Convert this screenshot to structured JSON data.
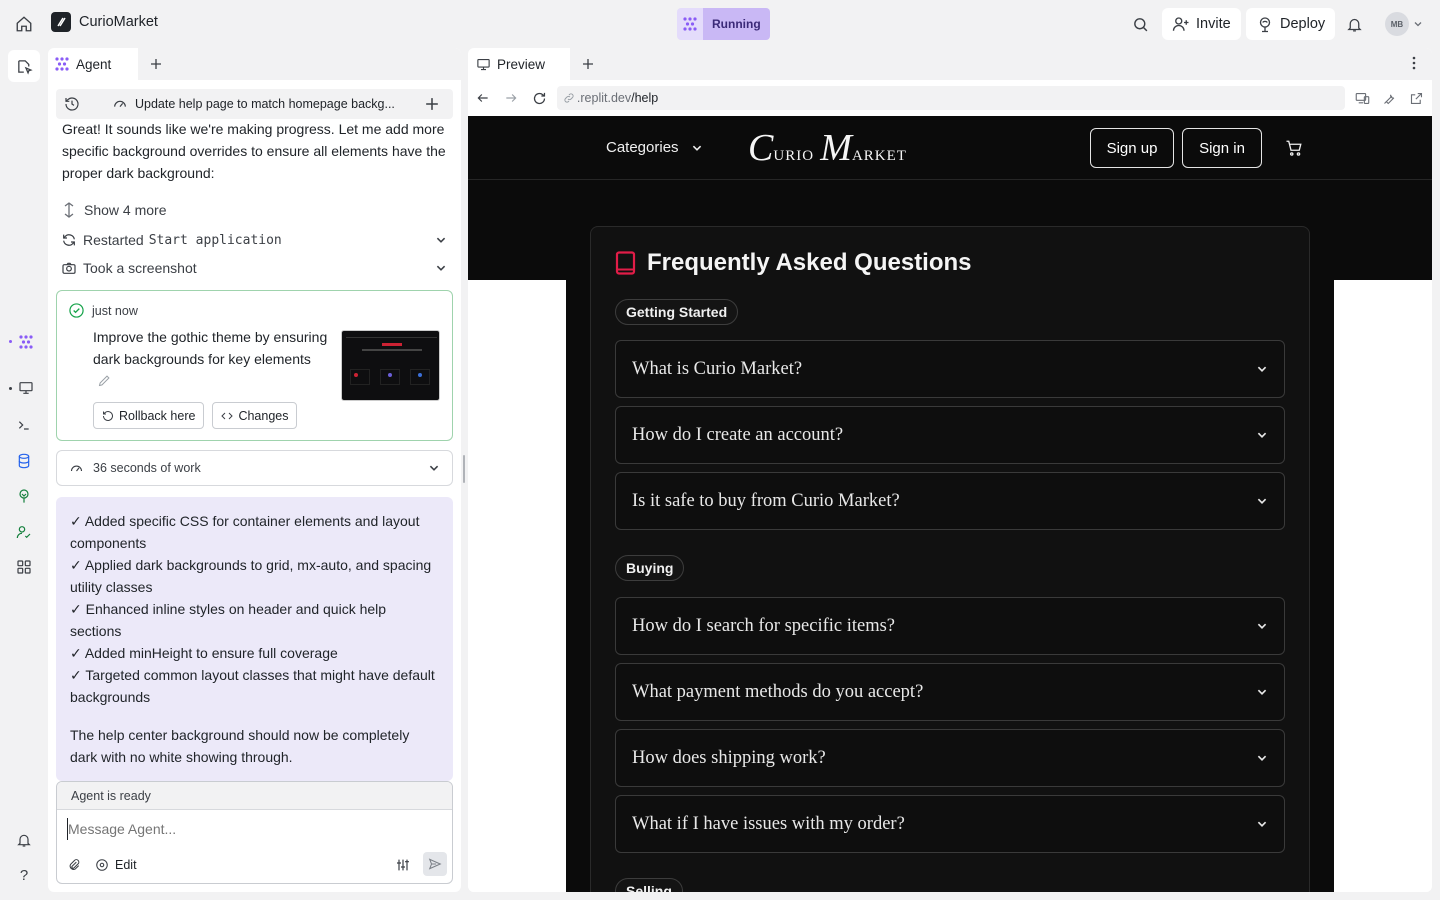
{
  "topbar": {
    "project_name": "CurioMarket",
    "status_label": "Running",
    "invite_label": "Invite",
    "deploy_label": "Deploy",
    "avatar_initials": "MB"
  },
  "agent": {
    "tab_label": "Agent",
    "thread_title": "Update help page to match homepage backg...",
    "intro_message": "Great! It sounds like we're making progress. Let me add more specific background overrides to ensure all elements have the proper dark background:",
    "show_more_label": "Show 4 more",
    "restarted_prefix": "Restarted",
    "restarted_code": "Start application",
    "screenshot_label": "Took a screenshot",
    "checkpoint": {
      "time": "just now",
      "description": "Improve the gothic theme by ensuring dark backgrounds for key elements",
      "rollback_label": "Rollback here",
      "changes_label": "Changes"
    },
    "work_summary": "36 seconds of work",
    "bullets": [
      "✓ Added specific CSS for container elements and layout components",
      "✓ Applied dark backgrounds to grid, mx-auto, and spacing utility classes",
      "✓ Enhanced inline styles on header and quick help sections",
      "✓ Added minHeight to ensure full coverage",
      "✓ Targeted common layout classes that might have default backgrounds"
    ],
    "closing_message": "The help center background should now be completely dark with no white showing through.",
    "status": "Agent is ready",
    "input_placeholder": "Message Agent...",
    "edit_label": "Edit"
  },
  "preview": {
    "tab_label": "Preview",
    "url_prefix": ".replit.dev",
    "url_path": "/help",
    "site": {
      "categories_label": "Categories",
      "logo_text_1": "C",
      "logo_text_2": "urio ",
      "logo_text_3": "M",
      "logo_text_4": "arket",
      "signup_label": "Sign up",
      "signin_label": "Sign in",
      "faq_title": "Frequently Asked Questions",
      "sections": [
        {
          "name": "Getting Started",
          "questions": [
            "What is Curio Market?",
            "How do I create an account?",
            "Is it safe to buy from Curio Market?"
          ]
        },
        {
          "name": "Buying",
          "questions": [
            "How do I search for specific items?",
            "What payment methods do you accept?",
            "How does shipping work?",
            "What if I have issues with my order?"
          ]
        },
        {
          "name": "Selling",
          "questions": []
        }
      ]
    }
  },
  "colors": {
    "accent_purple": "#8a5cf6",
    "status_pill_bg": "#c9b8f5",
    "agent_bubble_bg": "#ece9f9",
    "faq_icon_red": "#e11d48",
    "site_bg": "#0b0b0b"
  },
  "icons": [
    "home-icon",
    "replit-logo-icon",
    "agent-icon",
    "search-icon",
    "invite-icon",
    "deploy-icon",
    "bell-icon",
    "history-icon",
    "plus-icon",
    "chevron-down-icon",
    "refresh-icon",
    "camera-icon",
    "check-circle-icon",
    "pencil-icon",
    "rollback-icon",
    "code-icon",
    "gauge-icon",
    "paperclip-icon",
    "sliders-icon",
    "send-icon",
    "monitor-icon",
    "back-icon",
    "forward-icon",
    "link-icon",
    "devices-icon",
    "wrench-icon",
    "external-link-icon",
    "cart-icon",
    "book-icon",
    "terminal-icon",
    "database-icon",
    "tree-icon",
    "user-check-icon",
    "grid-icon",
    "help-icon",
    "bell-alert-icon",
    "more-icon"
  ]
}
